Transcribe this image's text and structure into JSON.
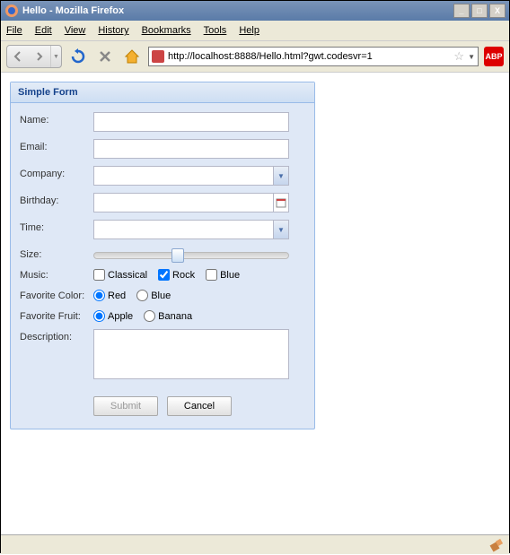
{
  "window": {
    "title": "Hello - Mozilla Firefox",
    "minimize": "_",
    "maximize": "□",
    "close": "X"
  },
  "menu": {
    "file": "File",
    "edit": "Edit",
    "view": "View",
    "history": "History",
    "bookmarks": "Bookmarks",
    "tools": "Tools",
    "help": "Help"
  },
  "toolbar": {
    "url": "http://localhost:8888/Hello.html?gwt.codesvr=1",
    "abp": "ABP"
  },
  "form": {
    "title": "Simple Form",
    "labels": {
      "name": "Name:",
      "email": "Email:",
      "company": "Company:",
      "birthday": "Birthday:",
      "time": "Time:",
      "size": "Size:",
      "music": "Music:",
      "favcolor": "Favorite Color:",
      "favfruit": "Favorite Fruit:",
      "description": "Description:"
    },
    "music": {
      "classical": "Classical",
      "rock": "Rock",
      "blue": "Blue",
      "rock_checked": true
    },
    "color": {
      "red": "Red",
      "blue": "Blue",
      "selected": "red"
    },
    "fruit": {
      "apple": "Apple",
      "banana": "Banana",
      "selected": "apple"
    },
    "buttons": {
      "submit": "Submit",
      "cancel": "Cancel"
    }
  }
}
